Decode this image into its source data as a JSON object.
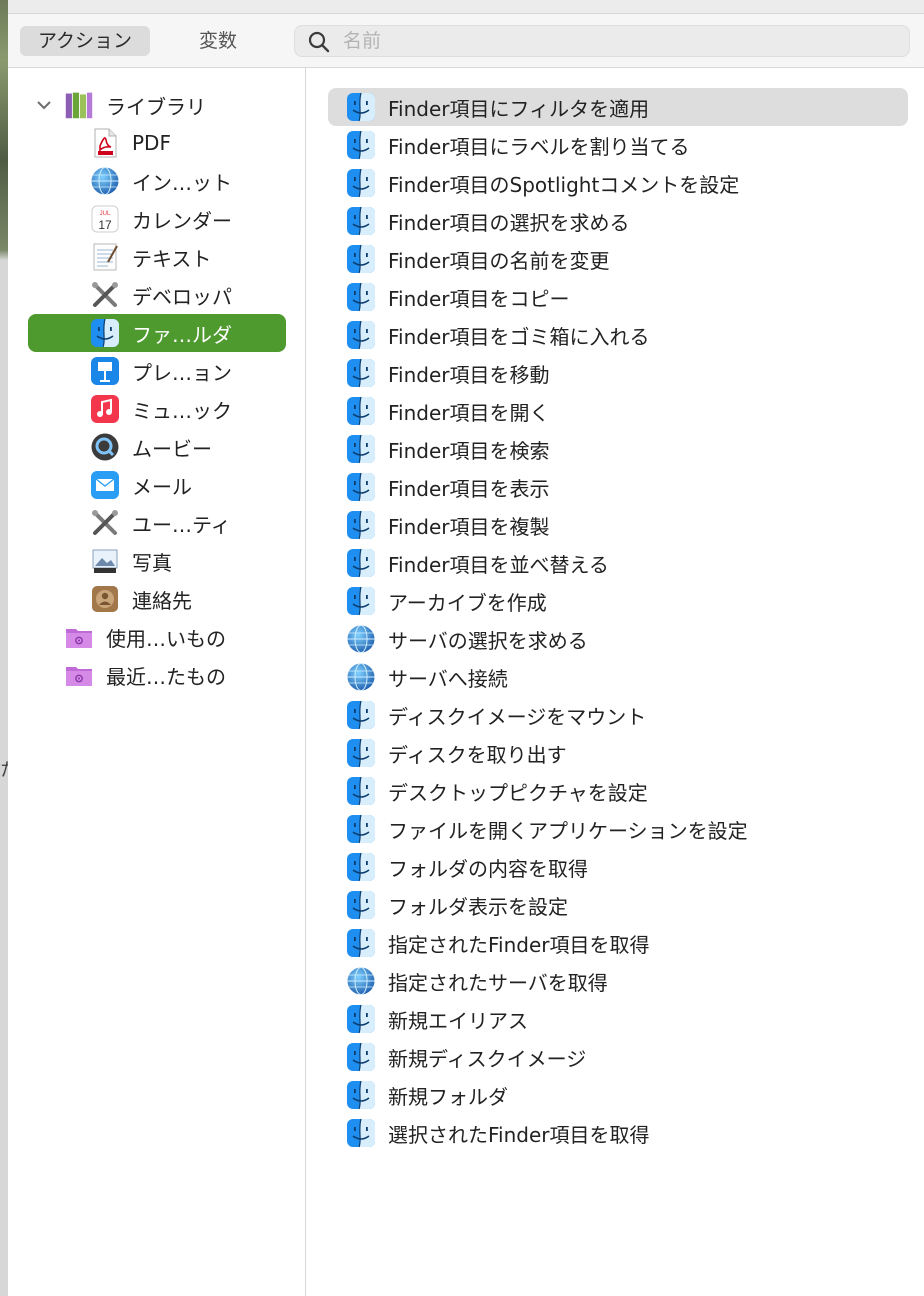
{
  "toolbar": {
    "tab_actions": "アクション",
    "tab_variables": "変数",
    "search_placeholder": "名前"
  },
  "sidebar": {
    "library": {
      "label": "ライブラリ",
      "icon": "library-books-icon"
    },
    "categories": [
      {
        "label": "PDF",
        "icon": "pdf-icon"
      },
      {
        "label": "イン…ット",
        "icon": "globe-icon"
      },
      {
        "label": "カレンダー",
        "icon": "calendar-icon",
        "calendar_month": "JUL",
        "calendar_day": "17"
      },
      {
        "label": "テキスト",
        "icon": "text-document-icon"
      },
      {
        "label": "デベロッパ",
        "icon": "developer-tools-icon"
      },
      {
        "label": "ファ…ルダ",
        "icon": "finder-icon",
        "selected": true
      },
      {
        "label": "プレ…ョン",
        "icon": "keynote-icon"
      },
      {
        "label": "ミュ…ック",
        "icon": "music-icon"
      },
      {
        "label": "ムービー",
        "icon": "quicktime-icon"
      },
      {
        "label": "メール",
        "icon": "mail-icon"
      },
      {
        "label": "ユー…ティ",
        "icon": "utilities-icon"
      },
      {
        "label": "写真",
        "icon": "photos-icon"
      },
      {
        "label": "連絡先",
        "icon": "contacts-icon"
      }
    ],
    "smart_folders": [
      {
        "label": "使用…いもの",
        "icon": "smart-folder-icon"
      },
      {
        "label": "最近…たもの",
        "icon": "smart-folder-icon"
      }
    ],
    "selected_color": "#4e9a2e"
  },
  "actions": [
    {
      "label": "Finder項目にフィルタを適用",
      "icon": "finder-icon",
      "selected": true
    },
    {
      "label": "Finder項目にラベルを割り当てる",
      "icon": "finder-icon"
    },
    {
      "label": "Finder項目のSpotlightコメントを設定",
      "icon": "finder-icon"
    },
    {
      "label": "Finder項目の選択を求める",
      "icon": "finder-icon"
    },
    {
      "label": "Finder項目の名前を変更",
      "icon": "finder-icon"
    },
    {
      "label": "Finder項目をコピー",
      "icon": "finder-icon"
    },
    {
      "label": "Finder項目をゴミ箱に入れる",
      "icon": "finder-icon"
    },
    {
      "label": "Finder項目を移動",
      "icon": "finder-icon"
    },
    {
      "label": "Finder項目を開く",
      "icon": "finder-icon"
    },
    {
      "label": "Finder項目を検索",
      "icon": "finder-icon"
    },
    {
      "label": "Finder項目を表示",
      "icon": "finder-icon"
    },
    {
      "label": "Finder項目を複製",
      "icon": "finder-icon"
    },
    {
      "label": "Finder項目を並べ替える",
      "icon": "finder-icon"
    },
    {
      "label": "アーカイブを作成",
      "icon": "finder-icon"
    },
    {
      "label": "サーバの選択を求める",
      "icon": "network-globe-icon"
    },
    {
      "label": "サーバへ接続",
      "icon": "network-globe-icon"
    },
    {
      "label": "ディスクイメージをマウント",
      "icon": "finder-icon"
    },
    {
      "label": "ディスクを取り出す",
      "icon": "finder-icon"
    },
    {
      "label": "デスクトップピクチャを設定",
      "icon": "finder-icon"
    },
    {
      "label": "ファイルを開くアプリケーションを設定",
      "icon": "finder-icon"
    },
    {
      "label": "フォルダの内容を取得",
      "icon": "finder-icon"
    },
    {
      "label": "フォルダ表示を設定",
      "icon": "finder-icon"
    },
    {
      "label": "指定されたFinder項目を取得",
      "icon": "finder-icon"
    },
    {
      "label": "指定されたサーバを取得",
      "icon": "network-globe-icon"
    },
    {
      "label": "新規エイリアス",
      "icon": "finder-icon"
    },
    {
      "label": "新規ディスクイメージ",
      "icon": "finder-icon"
    },
    {
      "label": "新規フォルダ",
      "icon": "finder-icon"
    },
    {
      "label": "選択されたFinder項目を取得",
      "icon": "finder-icon"
    }
  ]
}
